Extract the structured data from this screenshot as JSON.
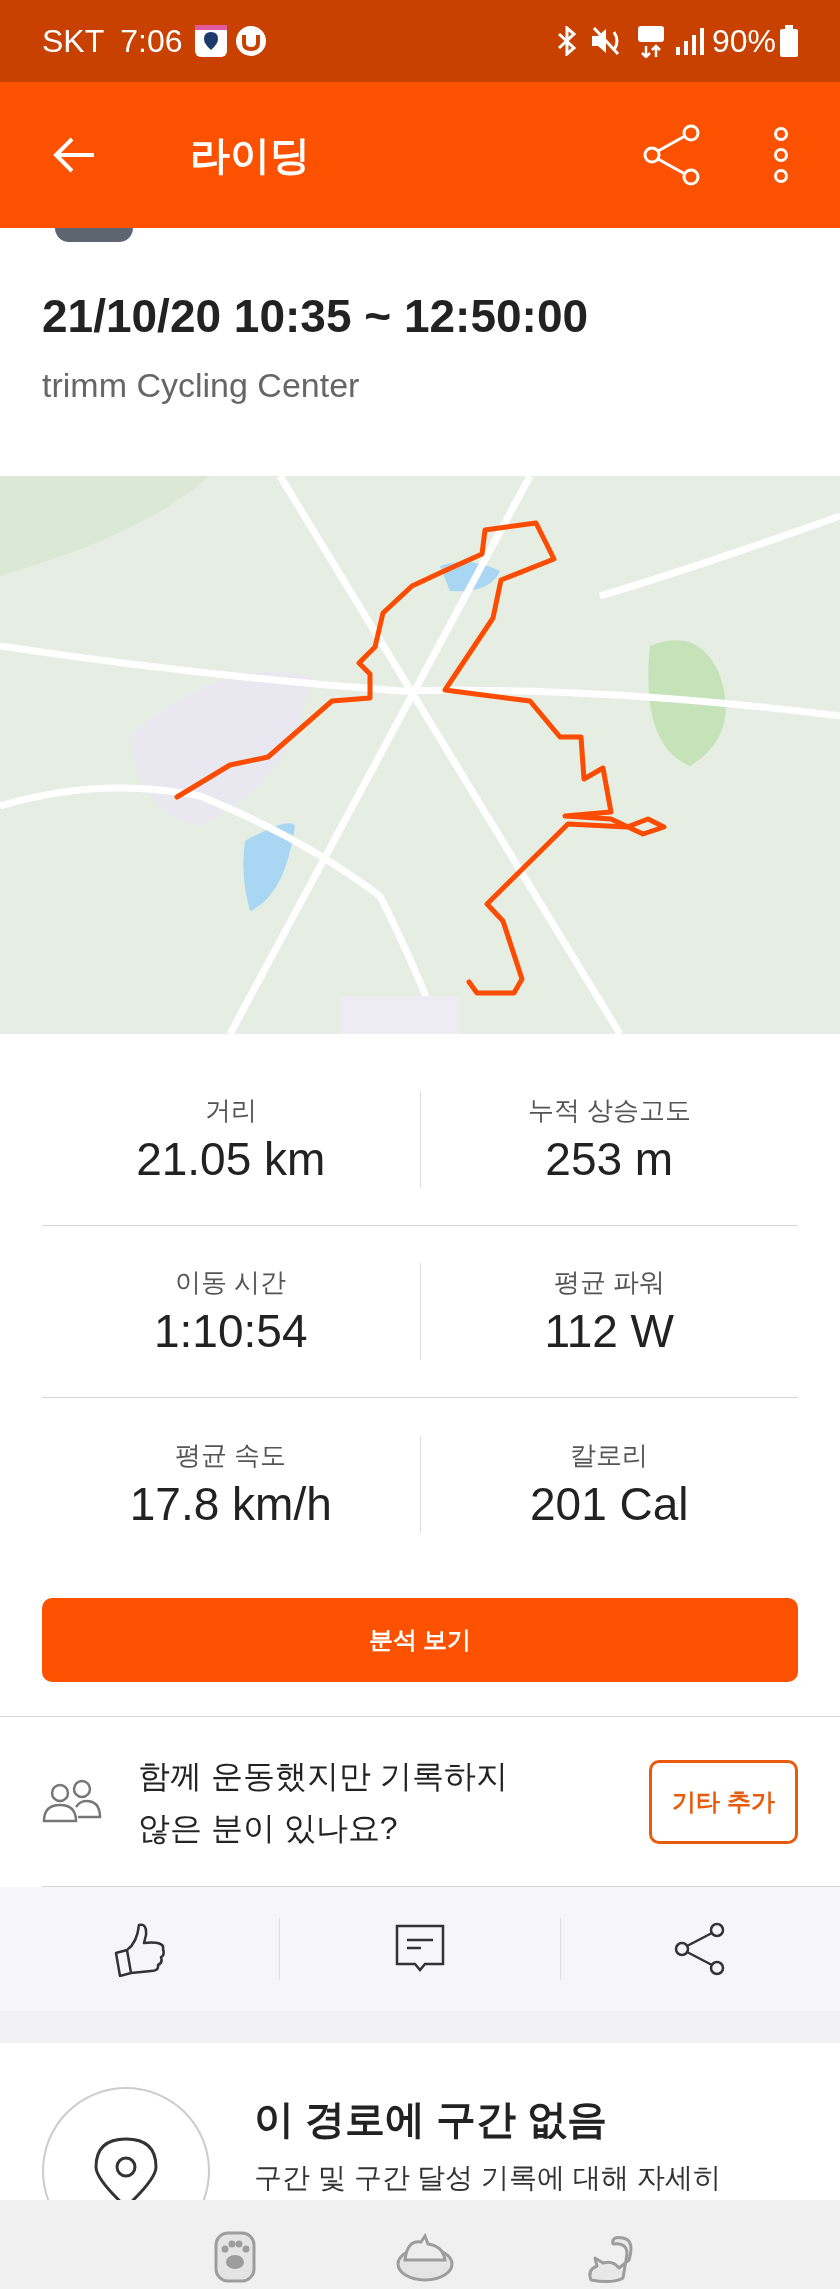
{
  "status_bar": {
    "carrier": "SKT",
    "time": "7:06",
    "battery": "90%"
  },
  "header": {
    "title": "라이딩"
  },
  "activity": {
    "title": "21/10/20 10:35 ~ 12:50:00",
    "location": "trimm Cycling Center"
  },
  "stats": [
    {
      "label": "거리",
      "value": "21.05 km"
    },
    {
      "label": "누적 상승고도",
      "value": "253 m"
    },
    {
      "label": "이동 시간",
      "value": "1:10:54"
    },
    {
      "label": "평균 파워",
      "value": "112 W"
    },
    {
      "label": "평균 속도",
      "value": "17.8 km/h"
    },
    {
      "label": "칼로리",
      "value": "201 Cal"
    }
  ],
  "analysis_button": "분석 보기",
  "partners": {
    "text": "함께 운동했지만 기록하지 않은 분이 있나요?",
    "button": "기타 추가"
  },
  "segments": {
    "title": "이 경로에 구간 없음",
    "text": "구간 및 구간 달성 기록에 대해 자세히"
  }
}
